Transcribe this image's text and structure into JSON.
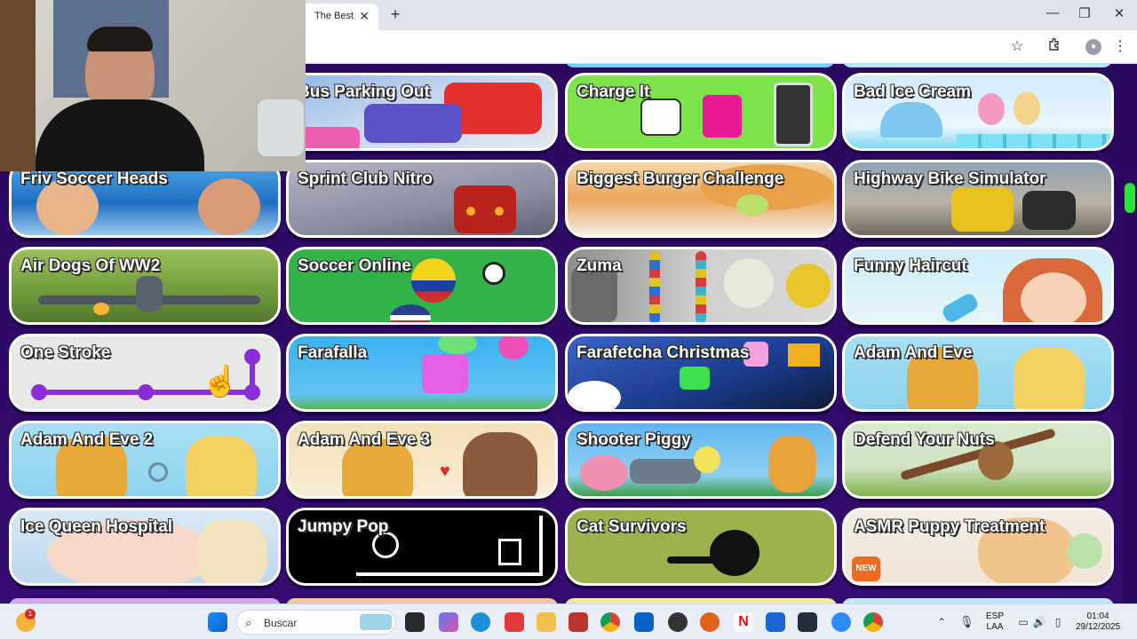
{
  "browser": {
    "tab_title": "The Best",
    "tab_close": "✕",
    "new_tab": "+",
    "window_controls": {
      "minimize": "—",
      "maximize": "❐",
      "close": "✕"
    },
    "toolbar_icons": [
      "star-icon",
      "extensions-icon",
      "profile-icon",
      "menu-icon"
    ]
  },
  "games": [
    {
      "title": "Bus Parking Out"
    },
    {
      "title": "Charge It"
    },
    {
      "title": "Bad Ice Cream"
    },
    {
      "title": "Friv Soccer Heads"
    },
    {
      "title": "Sprint Club Nitro"
    },
    {
      "title": "Biggest Burger Challenge"
    },
    {
      "title": "Highway Bike Simulator"
    },
    {
      "title": "Air Dogs Of WW2"
    },
    {
      "title": "Soccer Online"
    },
    {
      "title": "Zuma"
    },
    {
      "title": "Funny Haircut"
    },
    {
      "title": "One Stroke"
    },
    {
      "title": "Farafalla"
    },
    {
      "title": "Farafetcha Christmas"
    },
    {
      "title": "Adam And Eve"
    },
    {
      "title": "Adam And Eve 2"
    },
    {
      "title": "Adam And Eve 3"
    },
    {
      "title": "Shooter Piggy"
    },
    {
      "title": "Defend Your Nuts"
    },
    {
      "title": "Ice Queen Hospital"
    },
    {
      "title": "Jumpy Pop"
    },
    {
      "title": "Cat Survivors"
    },
    {
      "title": "ASMR Puppy Treatment"
    }
  ],
  "badges": {
    "new": "NEW"
  },
  "taskbar": {
    "search_placeholder": "Buscar",
    "notification_count": "1",
    "language": "ESP",
    "language_sub": "LAA",
    "time": "01:04",
    "date": "29/12/2025"
  },
  "colors": {
    "page_bg": "#340b70",
    "scroll_thumb": "#2fe23a",
    "card_border": "#ffffff"
  }
}
